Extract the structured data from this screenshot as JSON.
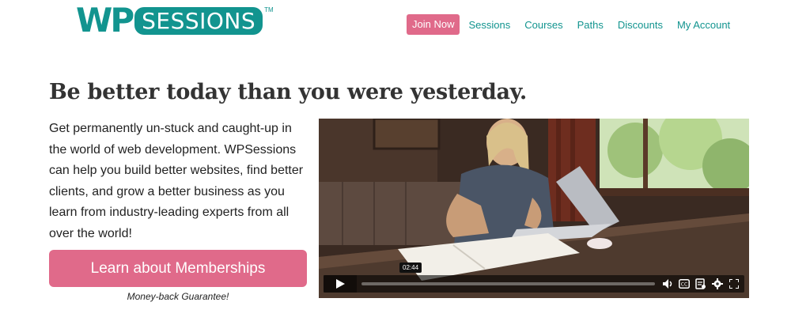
{
  "logo": {
    "part1": "WP",
    "part2": "SESSIONS",
    "trademark": "TM"
  },
  "nav": {
    "join": "Join Now",
    "items": [
      "Sessions",
      "Courses",
      "Paths",
      "Discounts",
      "My Account"
    ]
  },
  "hero": {
    "headline": "Be better today than you were yesterday.",
    "intro": "Get permanently un-stuck and caught-up in the world of web development. WPSessions can help you build better websites, find better clients, and grow a better business as you learn from industry-leading experts from all over the world!",
    "cta_label": "Learn about Memberships",
    "guarantee": "Money-back Guarantee!"
  },
  "video": {
    "timestamp": "02:44",
    "controls": [
      "play-icon",
      "volume-icon",
      "captions-icon",
      "transcript-icon",
      "settings-icon",
      "fullscreen-icon"
    ]
  },
  "colors": {
    "brand": "#12948f",
    "accent": "#e06a8a"
  }
}
